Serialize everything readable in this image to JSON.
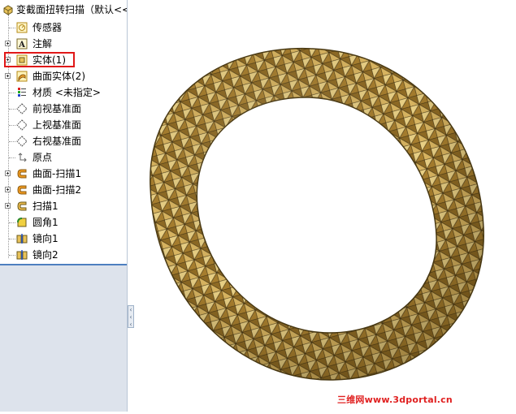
{
  "tree": {
    "root_label": "变截面扭转扫描（默认<<",
    "items": [
      {
        "label": "传感器",
        "icon": "sensor-icon"
      },
      {
        "label": "注解",
        "icon": "annotation-icon"
      },
      {
        "label": "实体(1)",
        "icon": "solid-body-icon"
      },
      {
        "label": "曲面实体(2)",
        "icon": "surface-body-icon"
      },
      {
        "label": "材质 <未指定>",
        "icon": "material-icon"
      },
      {
        "label": "前视基准面",
        "icon": "plane-icon"
      },
      {
        "label": "上视基准面",
        "icon": "plane-icon"
      },
      {
        "label": "右视基准面",
        "icon": "plane-icon"
      },
      {
        "label": "原点",
        "icon": "origin-icon"
      },
      {
        "label": "曲面-扫描1",
        "icon": "surface-sweep-icon"
      },
      {
        "label": "曲面-扫描2",
        "icon": "surface-sweep-icon"
      },
      {
        "label": "扫描1",
        "icon": "sweep-icon"
      },
      {
        "label": "圆角1",
        "icon": "fillet-icon"
      },
      {
        "label": "镜向1",
        "icon": "mirror-icon"
      },
      {
        "label": "镜向2",
        "icon": "mirror-icon"
      }
    ]
  },
  "viewport": {
    "model": "gold-textured-twisted-ring"
  },
  "watermark": "三维网www.3dportal.cn",
  "colors": {
    "highlight": "#e01818",
    "gold": "#c9a24c",
    "accent_blue": "#4d7fc0"
  }
}
